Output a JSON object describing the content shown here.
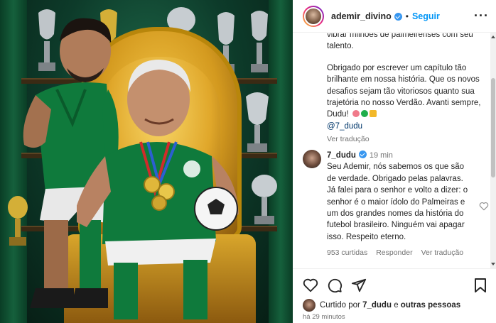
{
  "post": {
    "username": "ademir_divino",
    "follow_label": "Seguir",
    "separator": "•",
    "more_icon": "more-horizontal-icon"
  },
  "caption": {
    "line_top": "vibrar milhões de palmeirenses com seu talento.",
    "paragraph": "Obrigado por escrever um capítulo tão brilhante em nossa história. Que os novos desafios sejam tão vitoriosos quanto sua trajetória no nosso Verdão. Avanti sempre, Dudu!",
    "mention": "@7_dudu",
    "see_translation": "Ver tradução"
  },
  "comment": {
    "username": "7_dudu",
    "time": "19 min",
    "text": "Seu Ademir, nós sabemos os que são de verdade. Obrigado pelas palavras. Já falei para o senhor e volto a dizer: o senhor é o maior ídolo do Palmeiras e um dos grandes nomes da história do futebol brasileiro. Ninguém vai apagar isso. Respeito eterno.",
    "likes": "953 curtidas",
    "reply": "Responder",
    "see_translation": "Ver tradução"
  },
  "footer": {
    "liked_prefix": "Curtido por",
    "liked_user": "7_dudu",
    "liked_joiner": "e",
    "liked_suffix": "outras pessoas",
    "time_ago": "há 29 minutos"
  },
  "colors": {
    "accent": "#0095f6",
    "verified": "#3897f0",
    "muted": "#737373",
    "palmeiras_green": "#0f6b3a",
    "gold": "#d49a1f"
  }
}
